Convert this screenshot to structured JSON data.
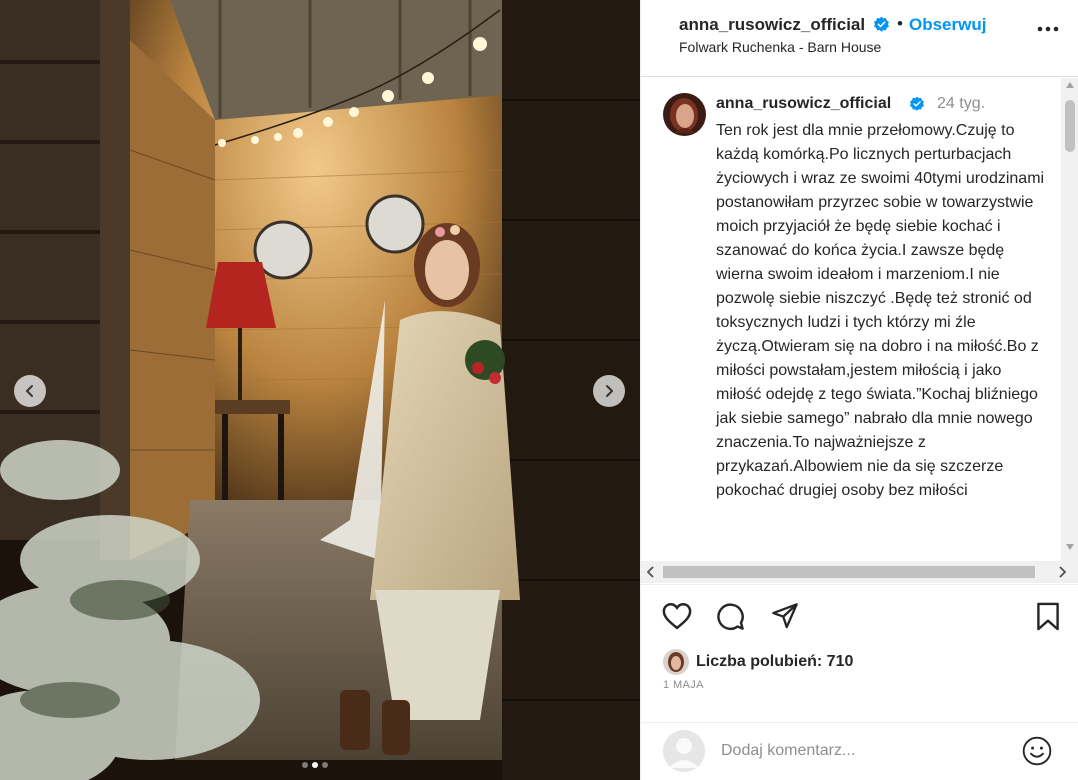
{
  "header": {
    "username": "anna_rusowicz_official",
    "separator": "•",
    "follow_label": "Obserwuj",
    "location": "Folwark Ruchenka - Barn House"
  },
  "caption": {
    "username": "anna_rusowicz_official",
    "time": "24 tyg.",
    "text": "Ten rok jest dla mnie przełomowy.Czuję to każdą komórką.Po licznych perturbacjach życiowych i wraz ze swoimi 40tymi urodzinami postanowiłam przyrzec sobie w towarzystwie moich przyjaciół że będę siebie kochać i szanować do końca życia.I zawsze będę wierna swoim ideałom i marzeniom.I nie pozwolę siebie niszczyć .Będę też stronić od toksycznych ludzi i tych którzy mi źle życzą.Otwieram się na dobro i na miłość.Bo z miłości powstałam,jestem miłością i jako miłość odejdę z tego świata.”Kochaj bliźniego jak siebie samego” nabrało dla mnie nowego znaczenia.To najważniejsze z przykazań.Albowiem nie da się szczerze pokochać drugiej osoby bez miłości"
  },
  "likes": {
    "label": "Liczba polubień: 710"
  },
  "date": "1 MAJA",
  "comment": {
    "placeholder": "Dodaj komentarz..."
  },
  "carousel": {
    "slide_count": 3,
    "active_index": 1
  },
  "colors": {
    "accent": "#0095f6",
    "text": "#262626",
    "muted": "#8e8e8e"
  },
  "icons": {
    "verified": "verified-badge-icon",
    "more": "more-options-icon",
    "like": "heart-icon",
    "comment": "comment-icon",
    "share": "share-icon",
    "save": "bookmark-icon",
    "emoji": "emoji-icon",
    "prev": "chevron-left-icon",
    "next": "chevron-right-icon"
  }
}
